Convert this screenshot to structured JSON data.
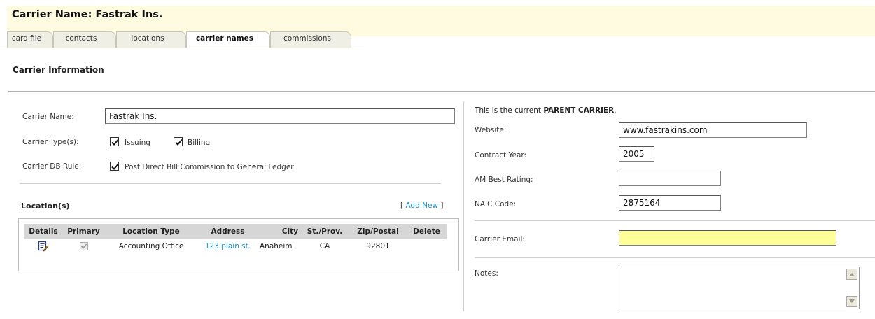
{
  "header": {
    "title": "Carrier Name: Fastrak Ins."
  },
  "tabs": [
    {
      "label": "card file",
      "active": false
    },
    {
      "label": "contacts",
      "active": false
    },
    {
      "label": "locations",
      "active": false
    },
    {
      "label": "carrier names",
      "active": true
    },
    {
      "label": "commissions",
      "active": false
    }
  ],
  "section": {
    "title": "Carrier Information"
  },
  "carrier": {
    "name_label": "Carrier Name:",
    "name_value": "Fastrak Ins.",
    "types_label": "Carrier Type(s):",
    "issuing_label": "Issuing",
    "issuing_checked": true,
    "billing_label": "Billing",
    "billing_checked": true,
    "db_rule_label": "Carrier DB Rule:",
    "db_rule_option": "Post Direct Bill Commission to General Ledger",
    "db_rule_checked": true
  },
  "locations": {
    "title": "Location(s)",
    "add_new_open": "[ ",
    "add_new_label": "Add New",
    "add_new_close": " ]",
    "columns": [
      "Details",
      "Primary",
      "Location Type",
      "Address",
      "City",
      "St./Prov.",
      "Zip/Postal",
      "Delete"
    ],
    "rows": [
      {
        "details_icon": "edit-icon",
        "primary_checked": true,
        "location_type": "Accounting Office",
        "address": "123 plain st.",
        "city": "Anaheim",
        "state": "CA",
        "zip": "92801"
      }
    ]
  },
  "right": {
    "parent_prefix": "This is the current ",
    "parent_bold": "PARENT CARRIER",
    "parent_suffix": ".",
    "website_label": "Website:",
    "website_value": "www.fastrakins.com",
    "contract_year_label": "Contract Year:",
    "contract_year_value": "2005",
    "am_best_label": "AM Best Rating:",
    "am_best_value": "",
    "naic_label": "NAIC Code:",
    "naic_value": "2875164",
    "email_label": "Carrier Email:",
    "email_value": "",
    "notes_label": "Notes:",
    "notes_value": ""
  },
  "colors": {
    "header_bg": "#fefbe0",
    "link": "#1a8fc4",
    "email_bg": "#ffff99",
    "table_header_bg": "#d6d6d6"
  }
}
